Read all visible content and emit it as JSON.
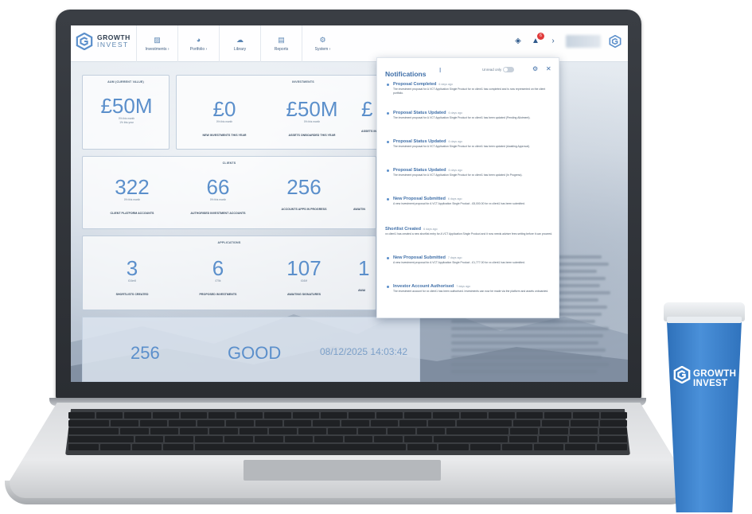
{
  "brand": {
    "name": "GROWTH",
    "sub": "INVEST"
  },
  "nav": {
    "items": [
      {
        "label": "Investments ›",
        "icon": "chart-icon"
      },
      {
        "label": "Portfolio ›",
        "icon": "pie-icon"
      },
      {
        "label": "Library",
        "icon": "cloud-icon"
      },
      {
        "label": "Reports",
        "icon": "document-icon"
      },
      {
        "label": "System ›",
        "icon": "gear-icon"
      }
    ],
    "notification_count": "6"
  },
  "dashboard": {
    "aum": {
      "title": "AUM (CURRENT VALUE)",
      "value": "£50M",
      "sub1": "0% this month",
      "sub2": "1% this year"
    },
    "investments": {
      "title": "INVESTMENTS",
      "stats": [
        {
          "value": "£0",
          "sub": "0% this month",
          "label": "NEW INVESTMENTS THIS YEAR"
        },
        {
          "value": "£50M",
          "sub": "0% this month",
          "label": "ASSETS ONBOARDED THIS YEAR"
        },
        {
          "value": "£",
          "sub": "",
          "label": "ASSETS IN"
        }
      ]
    },
    "clients": {
      "title": "CLIENTS",
      "stats": [
        {
          "value": "322",
          "sub": "0% this month",
          "label": "CLIENT PLATFORM ACCOUNTS"
        },
        {
          "value": "66",
          "sub": "0% this month",
          "label": "AUTHORISED INVESTMENT ACCOUNTS"
        },
        {
          "value": "256",
          "sub": "",
          "label": "ACCOUNTS APPS IN PROGRESS"
        },
        {
          "value": "",
          "sub": "",
          "label": "AWAITIN"
        }
      ]
    },
    "applications": {
      "title": "APPLICATIONS",
      "stats": [
        {
          "value": "3",
          "sub": "£16m8",
          "label": "SHORTLISTS CREATED"
        },
        {
          "value": "6",
          "sub": "£75k",
          "label": "PROPOSED INVESTMENTS"
        },
        {
          "value": "107",
          "sub": "£16M",
          "label": "AWAITING SIGNATURES"
        },
        {
          "value": "1",
          "sub": "",
          "label": "AWAI"
        }
      ]
    },
    "footer": {
      "count": "256",
      "status": "GOOD",
      "datetime": "08/12/2025 14:03:42"
    }
  },
  "notifications": {
    "title": "Notifications",
    "separator": "I",
    "unread_label": "Unread only",
    "items": [
      {
        "title": "Proposal Completed",
        "age": "6 days ago",
        "body": "The investment proposal for A VCT Application Single Product for xx client1 has completed and is now represented on the client portfolio."
      },
      {
        "title": "Proposal Status Updated",
        "age": "6 days ago",
        "body": "The investment proposal for A VCT Application Single Product for xx client1 has been updated (Pending Allotment)."
      },
      {
        "title": "Proposal Status Updated",
        "age": "6 days ago",
        "body": "The investment proposal for A VCT Application Single Product for xx client1 has been updated (Awaiting Approval)."
      },
      {
        "title": "Proposal Status Updated",
        "age": "6 days ago",
        "body": "The investment proposal for A VCT Application Single Product for xx client1 has been updated (In Progress)."
      },
      {
        "title": "New Proposal Submitted",
        "age": "6 days ago",
        "body": "A new investment proposal for A VCT Application Single Product - £8,000.00 for xx client1 has been submitted."
      },
      {
        "title": "Shortlist Created",
        "age": "6 days ago",
        "body": "xx client1 has created a new shortlist entry for A VCT Application Single Product and it now needs adviser fees setting before it can proceed."
      },
      {
        "title": "New Proposal Submitted",
        "age": "7 days ago",
        "body": "A new investment proposal for A VCT Application Single Product - £1,777.00 for xx client1 has been submitted."
      },
      {
        "title": "Investor Account Authorised",
        "age": "7 days ago",
        "body": "The investment account for xx client1 has been authorised. Investments can now be made via the platform and assets onboarded."
      }
    ]
  },
  "cup": {
    "line1": "GROWTH",
    "line2": "INVEST"
  },
  "colors": {
    "accent": "#5b8fcb",
    "brand": "#3f6fa8",
    "badge": "#e03a3a",
    "cup": "#3b82cf"
  }
}
